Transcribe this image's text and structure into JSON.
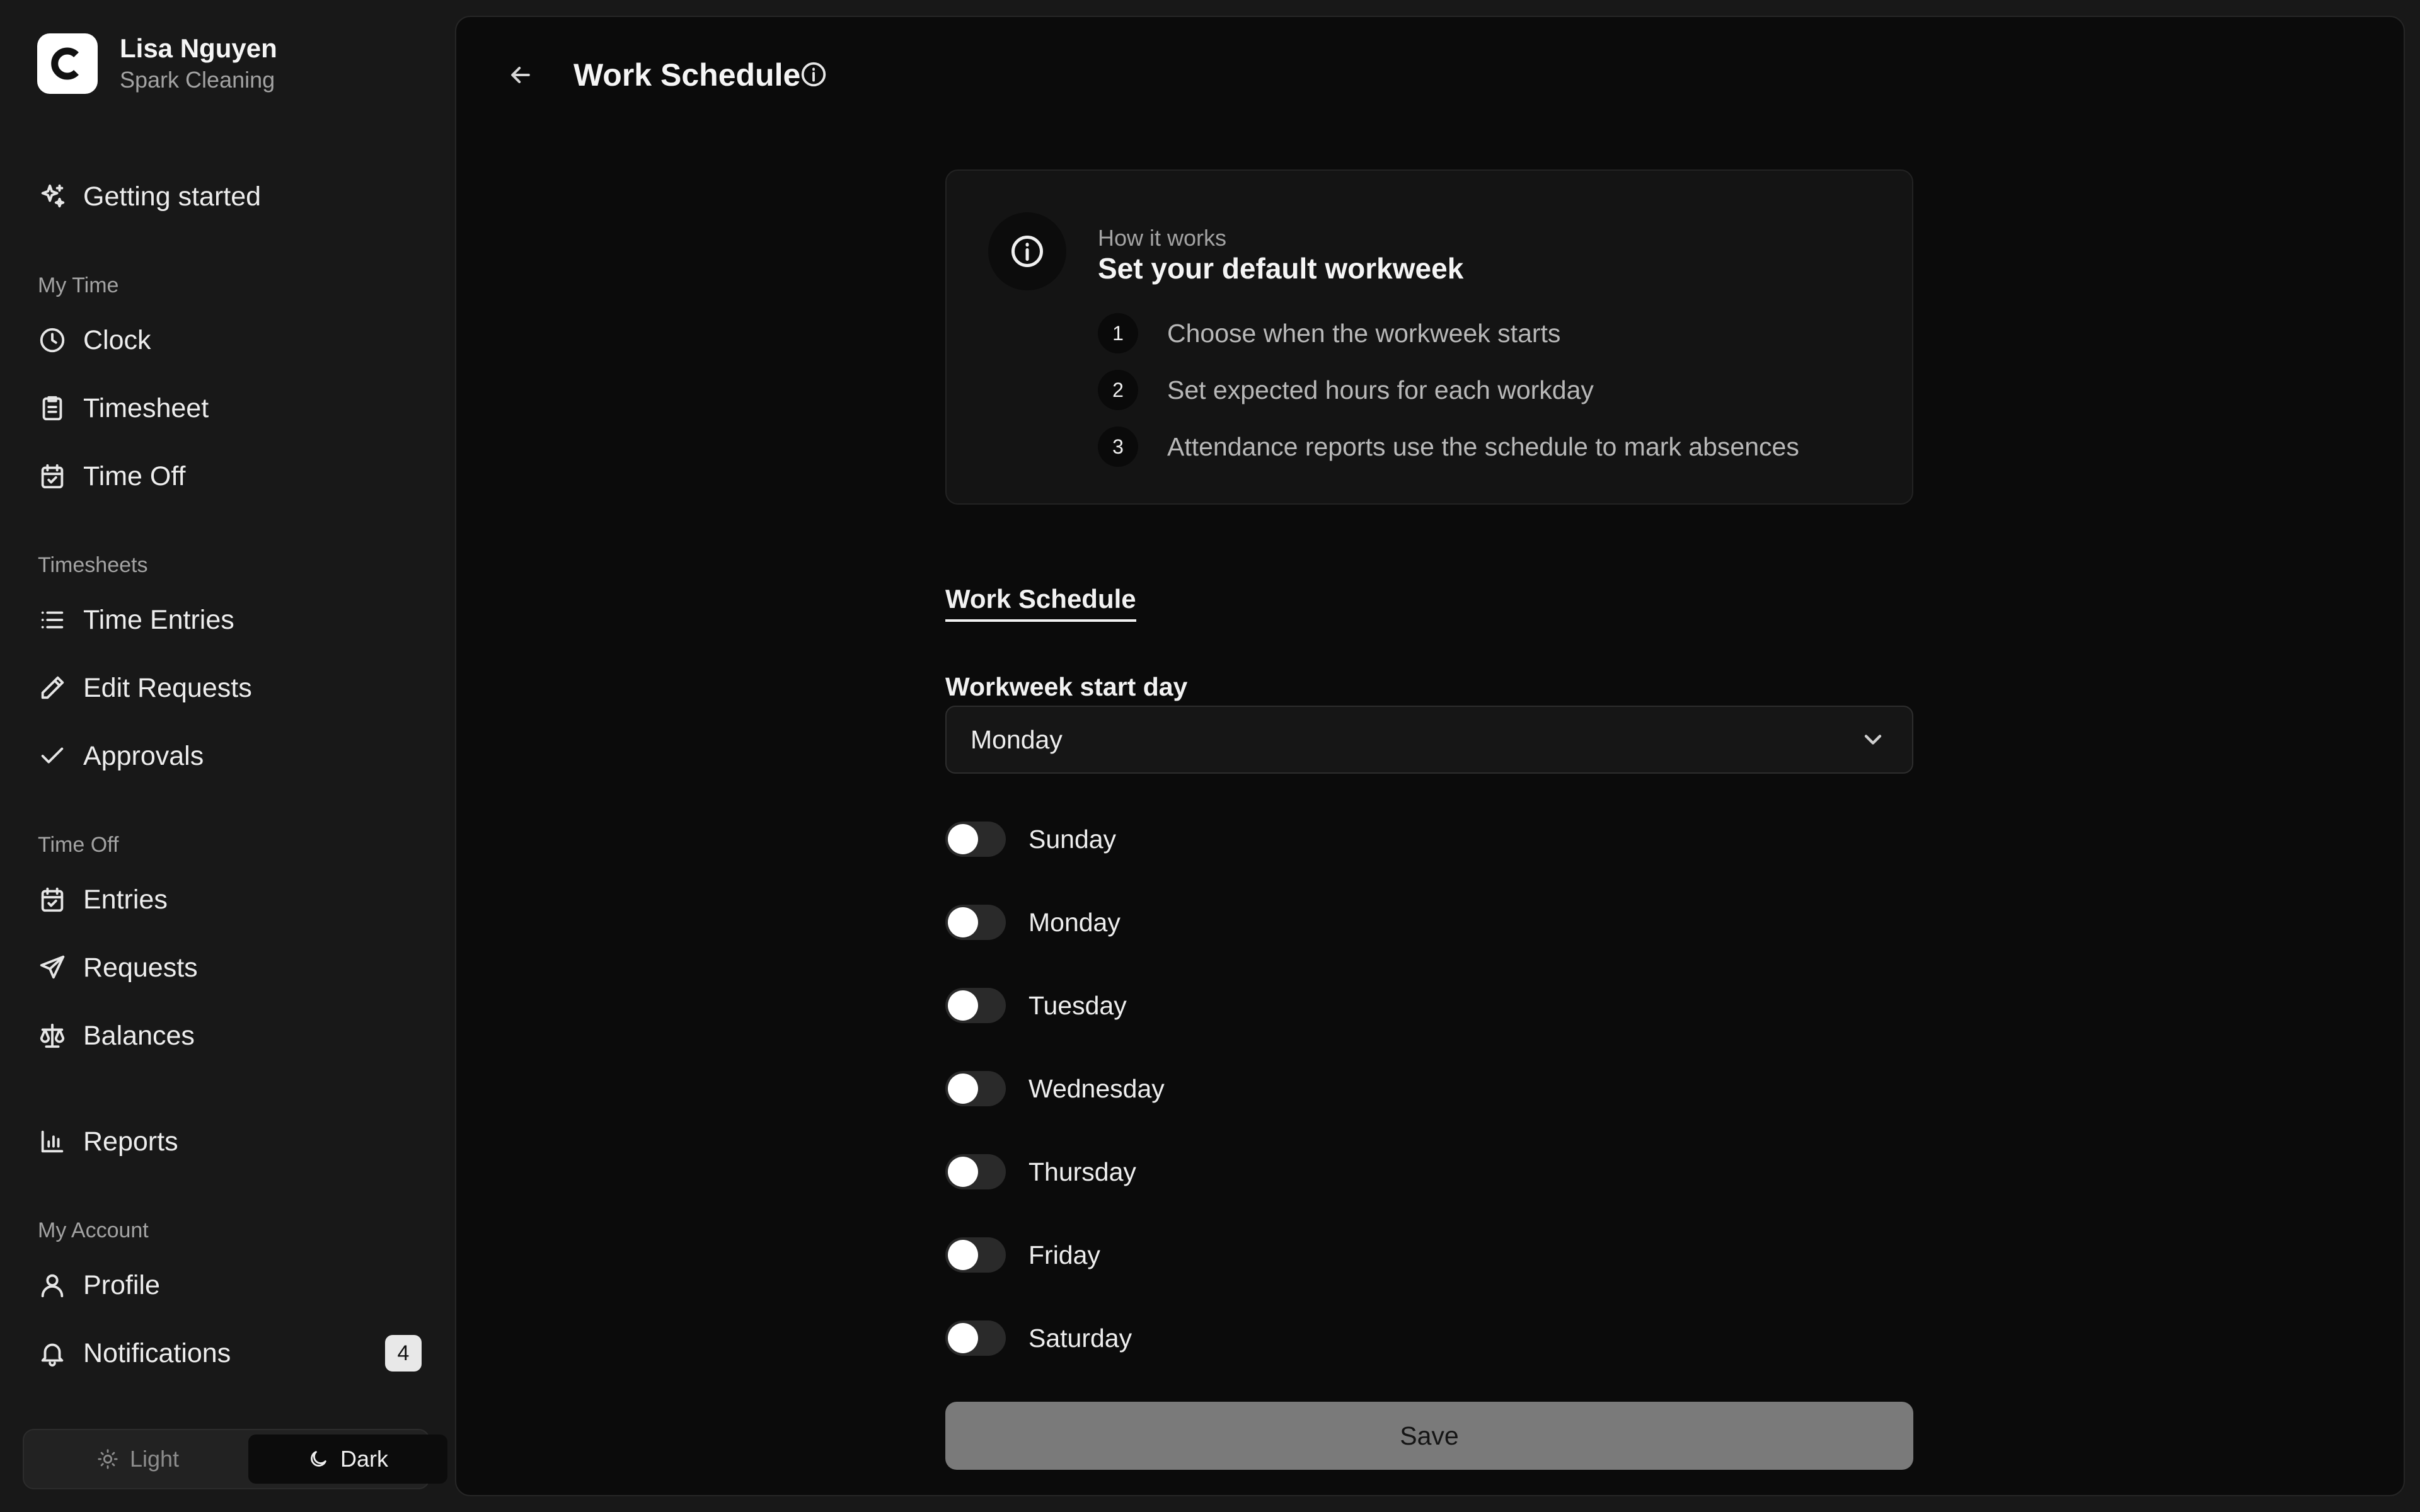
{
  "sidebar": {
    "user_name": "Lisa Nguyen",
    "company": "Spark Cleaning",
    "getting_started": "Getting started",
    "sections": {
      "my_time": "My Time",
      "timesheets": "Timesheets",
      "time_off": "Time Off",
      "my_account": "My Account"
    },
    "items": {
      "clock": "Clock",
      "timesheet": "Timesheet",
      "time_off": "Time Off",
      "time_entries": "Time Entries",
      "edit_requests": "Edit Requests",
      "approvals": "Approvals",
      "entries": "Entries",
      "requests": "Requests",
      "balances": "Balances",
      "reports": "Reports",
      "profile": "Profile",
      "notifications": "Notifications"
    },
    "notifications_badge": "4",
    "theme": {
      "light": "Light",
      "dark": "Dark",
      "selected": "Dark"
    }
  },
  "header": {
    "title": "Work Schedule"
  },
  "info_card": {
    "eyebrow": "How it works",
    "title": "Set your default workweek",
    "steps": [
      {
        "num": "1",
        "text": "Choose when the workweek starts"
      },
      {
        "num": "2",
        "text": "Set expected hours for each workday"
      },
      {
        "num": "3",
        "text": "Attendance reports use the schedule to mark absences"
      }
    ]
  },
  "form": {
    "tab": "Work Schedule",
    "start_day_label": "Workweek start day",
    "start_day_value": "Monday",
    "days": [
      {
        "label": "Sunday",
        "enabled": false
      },
      {
        "label": "Monday",
        "enabled": false
      },
      {
        "label": "Tuesday",
        "enabled": false
      },
      {
        "label": "Wednesday",
        "enabled": false
      },
      {
        "label": "Thursday",
        "enabled": false
      },
      {
        "label": "Friday",
        "enabled": false
      },
      {
        "label": "Saturday",
        "enabled": false
      }
    ],
    "save_label": "Save"
  }
}
